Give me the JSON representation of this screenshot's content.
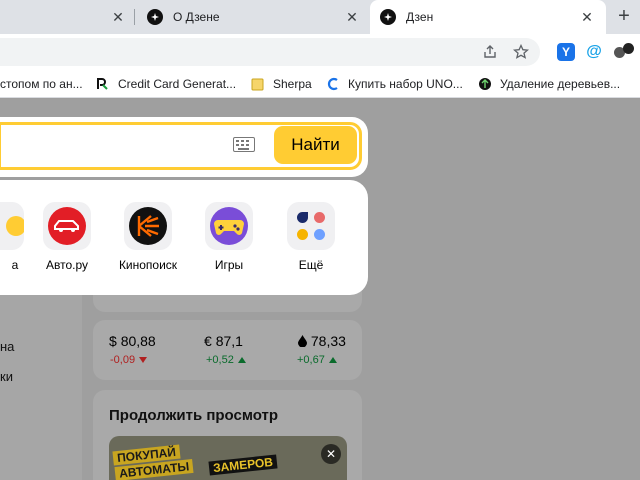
{
  "tabs": [
    {
      "title": "",
      "active": false
    },
    {
      "title": "О Дзене",
      "active": false
    },
    {
      "title": "Дзен",
      "active": true
    }
  ],
  "bookmarks": [
    {
      "label": "стопом по ан...",
      "icon": "none"
    },
    {
      "label": "Credit Card Generat...",
      "icon": "credit-card-generator-icon"
    },
    {
      "label": "Sherpa",
      "icon": "folder-icon"
    },
    {
      "label": "Купить набор UNO...",
      "icon": "uno-icon"
    },
    {
      "label": "Удаление деревьев...",
      "icon": "tree-removal-icon"
    }
  ],
  "search": {
    "button_label": "Найти",
    "placeholder": ""
  },
  "services": [
    {
      "label": "а",
      "icon": "partial-service-icon"
    },
    {
      "label": "Авто.ру",
      "icon": "car-icon"
    },
    {
      "label": "Кинопоиск",
      "icon": "kinopoisk-icon"
    },
    {
      "label": "Игры",
      "icon": "gamepad-icon"
    },
    {
      "label": "Ещё",
      "icon": "more-services-icon"
    }
  ],
  "left_links": [
    "на",
    "ки"
  ],
  "rates": [
    {
      "symbol": "$",
      "value": "80,88",
      "delta": "-0,09",
      "direction": "down"
    },
    {
      "symbol": "€",
      "value": "87,1",
      "delta": "+0,52",
      "direction": "up"
    },
    {
      "symbol": "💧",
      "value": "78,33",
      "delta": "+0,67",
      "direction": "up"
    }
  ],
  "continue": {
    "title": "Продолжить просмотр",
    "thumb_line1": "ПОКУПАЙ",
    "thumb_line2": "АВТОМАТЫ",
    "thumb_line3": "ЗАМЕРОВ"
  },
  "colors": {
    "accent": "#ffcc33",
    "up": "#0a6b2c",
    "down": "#b02020"
  }
}
